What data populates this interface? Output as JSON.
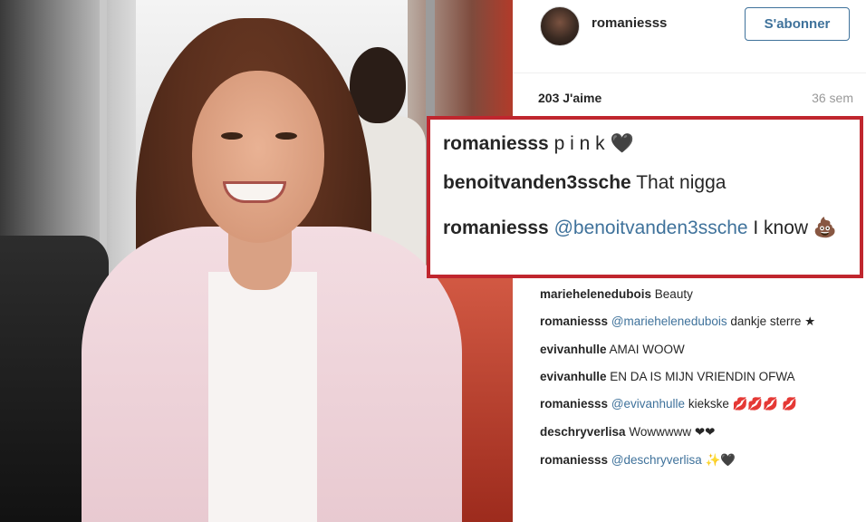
{
  "post": {
    "username": "romaniesss",
    "follow_label": "S'abonner",
    "likes": "203 J'aime",
    "time": "36 sem"
  },
  "highlighted_comments": [
    {
      "user": "romaniesss",
      "text": " p i n k ",
      "emoji": "🖤"
    },
    {
      "user": "benoitvanden3ssche",
      "text": " That nigga"
    },
    {
      "user": "romaniesss",
      "mention": "@benoitvanden3ssche",
      "text": " I know ",
      "emoji": "💩"
    }
  ],
  "comments": [
    {
      "user": "mariehelenedubois",
      "text": " Beauty"
    },
    {
      "user": "romaniesss",
      "mention": "@mariehelenedubois",
      "text": " dankje sterre ",
      "emoji": "★"
    },
    {
      "user": "evivanhulle",
      "text": " AMAI WOOW"
    },
    {
      "user": "evivanhulle",
      "text": " EN DA IS MIJN VRIENDIN OFWA"
    },
    {
      "user": "romaniesss",
      "mention": "@evivanhulle",
      "text": " kiekske ",
      "emoji": "💋💋💋 💋"
    },
    {
      "user": "deschryverlisa",
      "text": " Wowwwww ",
      "emoji": "❤❤"
    },
    {
      "user": "romaniesss",
      "mention": "@deschryverlisa",
      "text": " ",
      "emoji": "✨🖤"
    }
  ],
  "icons": {
    "avatar": "profile-avatar",
    "heart": "black-heart-emoji",
    "poop": "poop-emoji"
  }
}
